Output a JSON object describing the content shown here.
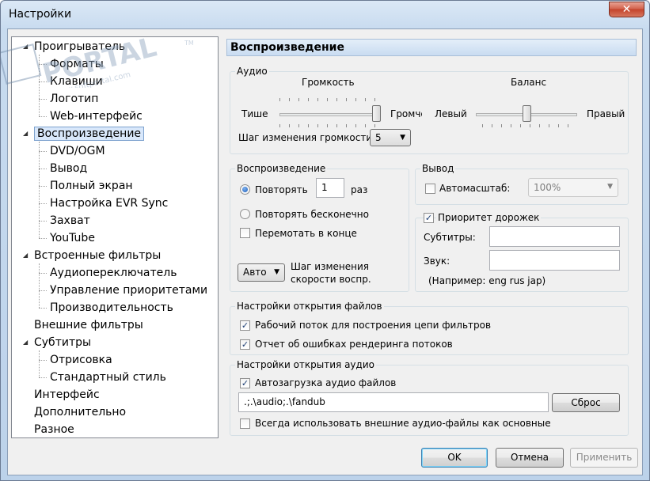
{
  "window": {
    "title": "Настройки",
    "close_glyph": "✕"
  },
  "watermark": {
    "text": "PORTAL",
    "sub": "www.softportal.com",
    "tm": "TM"
  },
  "tree": {
    "items": [
      {
        "label": "Проигрыватель",
        "level": 0,
        "expanded": true
      },
      {
        "label": "Форматы",
        "level": 1
      },
      {
        "label": "Клавиши",
        "level": 1
      },
      {
        "label": "Логотип",
        "level": 1
      },
      {
        "label": "Web-интерфейс",
        "level": 1
      },
      {
        "label": "Воспроизведение",
        "level": 0,
        "expanded": true,
        "selected": true
      },
      {
        "label": "DVD/OGM",
        "level": 1
      },
      {
        "label": "Вывод",
        "level": 1
      },
      {
        "label": "Полный экран",
        "level": 1
      },
      {
        "label": "Настройка EVR Sync",
        "level": 1
      },
      {
        "label": "Захват",
        "level": 1
      },
      {
        "label": "YouTube",
        "level": 1
      },
      {
        "label": "Встроенные фильтры",
        "level": 0,
        "expanded": true
      },
      {
        "label": "Аудиопереключатель",
        "level": 1
      },
      {
        "label": "Управление приоритетами",
        "level": 1
      },
      {
        "label": "Производительность",
        "level": 1
      },
      {
        "label": "Внешние фильтры",
        "level": 0
      },
      {
        "label": "Субтитры",
        "level": 0,
        "expanded": true
      },
      {
        "label": "Отрисовка",
        "level": 1
      },
      {
        "label": "Стандартный стиль",
        "level": 1
      },
      {
        "label": "Интерфейс",
        "level": 0
      },
      {
        "label": "Дополнительно",
        "level": 0
      },
      {
        "label": "Разное",
        "level": 0
      }
    ]
  },
  "panel": {
    "title": "Воспроизведение"
  },
  "audio": {
    "group_title": "Аудио",
    "volume_label": "Громкость",
    "volume_min": "Тише",
    "volume_max": "Громче",
    "volume_level": 1.0,
    "balance_label": "Баланс",
    "balance_left": "Левый",
    "balance_right": "Правый",
    "balance_level": 0.5,
    "step_label": "Шаг изменения громкости:",
    "step_value": "5"
  },
  "playback": {
    "group_title": "Воспроизведение",
    "repeat_label": "Повторять",
    "repeat_count": "1",
    "repeat_unit": "раз",
    "repeat_forever_label": "Повторять бесконечно",
    "rewind_label": "Перемотать в конце",
    "speed_combo": "Авто",
    "speed_label_1": "Шаг изменения",
    "speed_label_2": "скорости воспр."
  },
  "output": {
    "group_title": "Вывод",
    "autozoom_label": "Автомасштаб:",
    "autozoom_value": "100%"
  },
  "tracks": {
    "priority_label": "Приоритет дорожек",
    "subtitles_label": "Субтитры:",
    "subtitles_value": "",
    "audio_label": "Звук:",
    "audio_value": "",
    "example": "(Например: eng rus jap)"
  },
  "file_open": {
    "group_title": "Настройки открытия файлов",
    "worker_thread": "Рабочий поток для построения цепи фильтров",
    "error_report": "Отчет об ошибках рендеринга потоков"
  },
  "audio_open": {
    "group_title": "Настройки открытия аудио",
    "autoload_label": "Автозагрузка аудио файлов",
    "paths": ".;.\\audio;.\\fandub",
    "reset_label": "Сброс",
    "always_external": "Всегда использовать внешние аудио-файлы как основные"
  },
  "footer": {
    "ok": "OK",
    "cancel": "Отмена",
    "apply": "Применить"
  },
  "check_glyph": "✓"
}
